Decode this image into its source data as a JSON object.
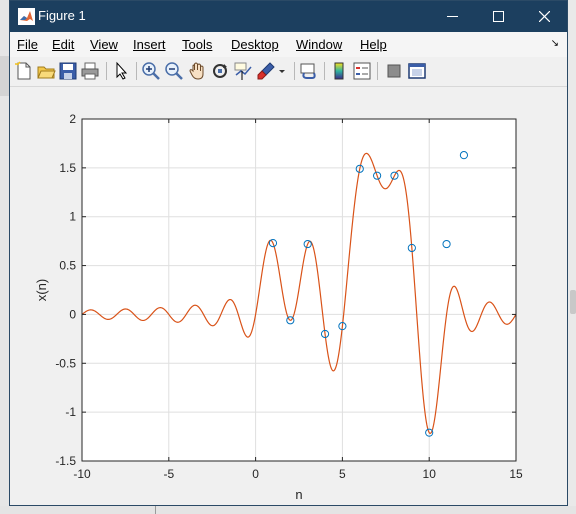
{
  "window": {
    "title": "Figure 1"
  },
  "menu": [
    "File",
    "Edit",
    "View",
    "Insert",
    "Tools",
    "Desktop",
    "Window",
    "Help"
  ],
  "menu_arrow": "↘",
  "toolbar_icons": [
    "new-figure-icon",
    "open-file-icon",
    "save-icon",
    "print-icon",
    "select-arrow-icon",
    "zoom-in-icon",
    "zoom-out-icon",
    "pan-icon",
    "rotate-3d-icon",
    "data-cursor-icon",
    "brush-icon",
    "link-plot-icon",
    "colorbar-icon",
    "legend-icon",
    "hide-plot-tools-icon",
    "show-plot-tools-icon"
  ],
  "colors": {
    "titlebar": "#1c3f5f",
    "marker": "#0072bd",
    "curve": "#d95319"
  },
  "chart_data": {
    "type": "scatter",
    "xlabel": "n",
    "ylabel": "x(n)",
    "xlim": [
      -10,
      15
    ],
    "ylim": [
      -1.5,
      2
    ],
    "xticks": [
      -10,
      -5,
      0,
      5,
      10,
      15
    ],
    "yticks": [
      -1.5,
      -1,
      -0.5,
      0,
      0.5,
      1,
      1.5,
      2
    ],
    "grid": true,
    "series": [
      {
        "style": "markers",
        "x": [
          1,
          2,
          3,
          4,
          5,
          6,
          7,
          8,
          9,
          10,
          11,
          12
        ],
        "y": [
          0.73,
          -0.06,
          0.72,
          -0.2,
          -0.12,
          1.49,
          1.42,
          1.42,
          0.68,
          -1.21,
          0.72,
          1.63
        ]
      },
      {
        "style": "line",
        "interpolation": "sinc reconstruction of samples n = 1..10",
        "x_range": [
          -10,
          15
        ]
      }
    ]
  }
}
